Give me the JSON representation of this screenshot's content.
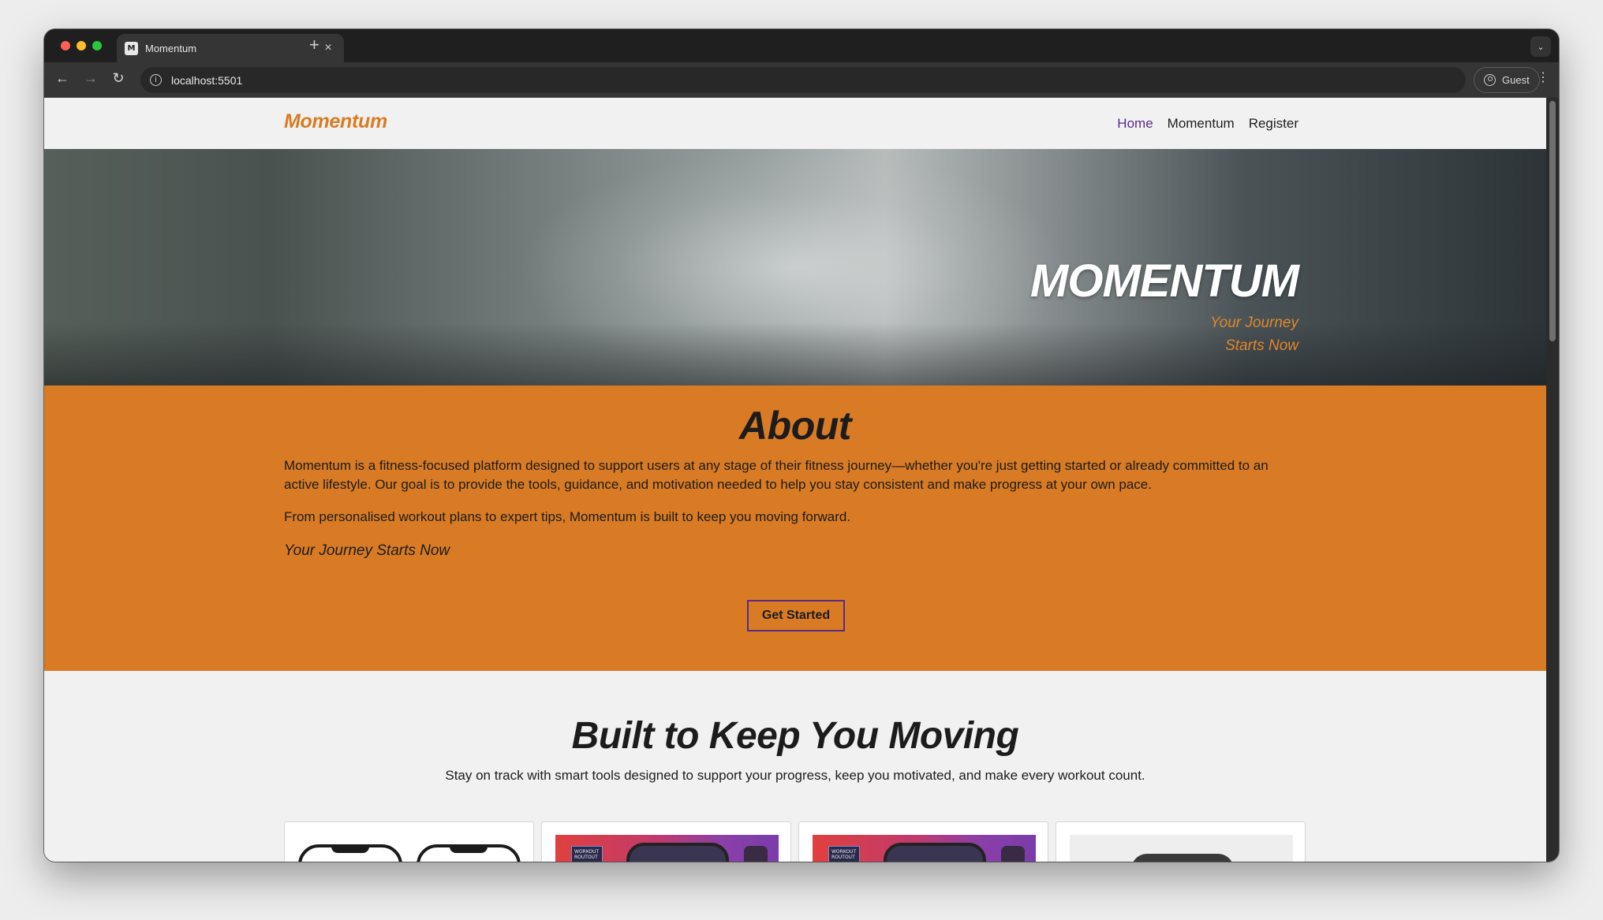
{
  "browser": {
    "tab_title": "Momentum",
    "tab_favicon_text": "M",
    "url": "localhost:5501",
    "profile_label": "Guest"
  },
  "site": {
    "brand": "Momentum",
    "nav": [
      {
        "label": "Home",
        "active": true
      },
      {
        "label": "Momentum",
        "active": false
      },
      {
        "label": "Register",
        "active": false
      }
    ]
  },
  "hero": {
    "title": "MOMENTUM",
    "subtitle": "Your Journey Starts Now"
  },
  "about": {
    "title": "About",
    "paragraph1": "Momentum is a fitness-focused platform designed to support users at any stage of their fitness journey—whether you're just getting started or already committed to an active lifestyle. Our goal is to provide the tools, guidance, and motivation needed to help you stay consistent and make progress at your own pace.",
    "paragraph2": "From personalised workout plans to expert tips, Momentum is built to keep you moving forward.",
    "tagline": "Your Journey Starts Now",
    "cta_label": "Get Started"
  },
  "features": {
    "title": "Built to Keep You Moving",
    "subtitle": "Stay on track with smart tools designed to support your progress, keep you motivated, and make every workout count.",
    "promo_label": "WORKOUT ROUTOUT"
  },
  "colors": {
    "accent_orange": "#d87b24",
    "active_nav_purple": "#5b2a86",
    "page_background": "#f1f1f1"
  }
}
